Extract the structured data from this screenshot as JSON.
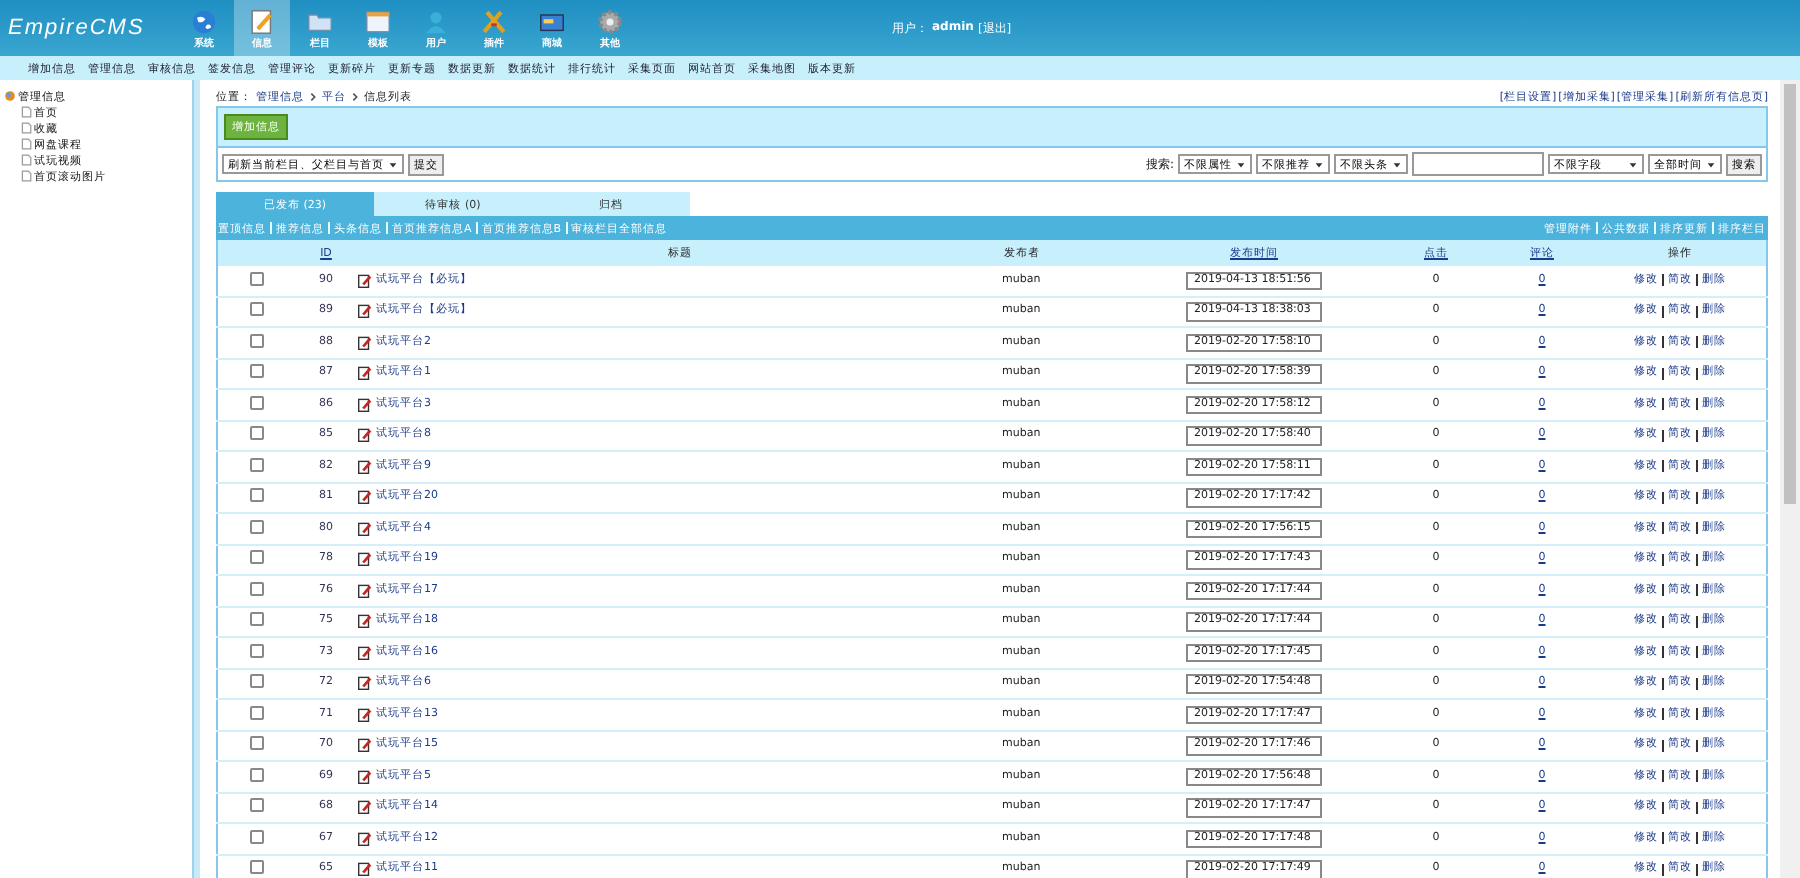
{
  "header": {
    "logo": "EmpireCMS",
    "nav": [
      {
        "label": "系统",
        "selected": false
      },
      {
        "label": "信息",
        "selected": true
      },
      {
        "label": "栏目",
        "selected": false
      },
      {
        "label": "模板",
        "selected": false
      },
      {
        "label": "用户",
        "selected": false
      },
      {
        "label": "插件",
        "selected": false
      },
      {
        "label": "商城",
        "selected": false
      },
      {
        "label": "其他",
        "selected": false
      }
    ],
    "user_label": "用户：",
    "user": "admin",
    "logout": "[退出]"
  },
  "submenu": [
    "增加信息",
    "管理信息",
    "审核信息",
    "签发信息",
    "管理评论",
    "更新碎片",
    "更新专题",
    "数据更新",
    "数据统计",
    "排行统计",
    "采集页面",
    "网站首页",
    "采集地图",
    "版本更新"
  ],
  "sidebar": {
    "root": "管理信息",
    "children": [
      {
        "label": "首页"
      },
      {
        "label": "收藏"
      },
      {
        "label": "网盘课程"
      },
      {
        "label": "试玩视频"
      },
      {
        "label": "首页滚动图片"
      }
    ]
  },
  "breadcrumb": {
    "label": "位置：",
    "items": [
      "管理信息",
      "平台",
      "信息列表"
    ]
  },
  "top_links": [
    "[栏目设置]",
    "[增加采集]",
    "[管理采集]",
    "[刷新所有信息页]"
  ],
  "add_button": "增加信息",
  "refresh_select": "刷新当前栏目、父栏目与首页",
  "submit_button": "提交",
  "search": {
    "label": "搜索:",
    "selects": [
      "不限属性",
      "不限推荐",
      "不限头条"
    ],
    "field_select": "不限字段",
    "time_select": "全部时间",
    "button": "搜索"
  },
  "tabs": [
    {
      "label": "已发布 (23)",
      "selected": true
    },
    {
      "label": "待审核 (0)",
      "selected": false
    },
    {
      "label": "归档",
      "selected": false
    }
  ],
  "filter_links": [
    "置顶信息",
    "推荐信息",
    "头条信息",
    "首页推荐信息A",
    "首页推荐信息B",
    "审核栏目全部信息"
  ],
  "tool_links": [
    "管理附件",
    "公共数据",
    "排序更新",
    "排序栏目"
  ],
  "table": {
    "columns": [
      "ID",
      "标题",
      "发布者",
      "发布时间",
      "点击",
      "评论",
      "操作"
    ],
    "rows": [
      {
        "checked": false,
        "id": "90",
        "title": "试玩平台【必玩】",
        "author": "muban",
        "time": "2019-04-13 18:51:56",
        "clicks": "0",
        "comments": "0",
        "actions": [
          "修改",
          "简改",
          "删除"
        ]
      },
      {
        "checked": false,
        "id": "89",
        "title": "试玩平台【必玩】",
        "author": "muban",
        "time": "2019-04-13 18:38:03",
        "clicks": "0",
        "comments": "0",
        "actions": [
          "修改",
          "简改",
          "删除"
        ]
      },
      {
        "checked": false,
        "id": "88",
        "title": "试玩平台2",
        "author": "muban",
        "time": "2019-02-20 17:58:10",
        "clicks": "0",
        "comments": "0",
        "actions": [
          "修改",
          "简改",
          "删除"
        ]
      },
      {
        "checked": false,
        "id": "87",
        "title": "试玩平台1",
        "author": "muban",
        "time": "2019-02-20 17:58:39",
        "clicks": "0",
        "comments": "0",
        "actions": [
          "修改",
          "简改",
          "删除"
        ]
      },
      {
        "checked": false,
        "id": "86",
        "title": "试玩平台3",
        "author": "muban",
        "time": "2019-02-20 17:58:12",
        "clicks": "0",
        "comments": "0",
        "actions": [
          "修改",
          "简改",
          "删除"
        ]
      },
      {
        "checked": false,
        "id": "85",
        "title": "试玩平台8",
        "author": "muban",
        "time": "2019-02-20 17:58:40",
        "clicks": "0",
        "comments": "0",
        "actions": [
          "修改",
          "简改",
          "删除"
        ]
      },
      {
        "checked": false,
        "id": "82",
        "title": "试玩平台9",
        "author": "muban",
        "time": "2019-02-20 17:58:11",
        "clicks": "0",
        "comments": "0",
        "actions": [
          "修改",
          "简改",
          "删除"
        ]
      },
      {
        "checked": false,
        "id": "81",
        "title": "试玩平台20",
        "author": "muban",
        "time": "2019-02-20 17:17:42",
        "clicks": "0",
        "comments": "0",
        "actions": [
          "修改",
          "简改",
          "删除"
        ]
      },
      {
        "checked": false,
        "id": "80",
        "title": "试玩平台4",
        "author": "muban",
        "time": "2019-02-20 17:56:15",
        "clicks": "0",
        "comments": "0",
        "actions": [
          "修改",
          "简改",
          "删除"
        ]
      },
      {
        "checked": false,
        "id": "78",
        "title": "试玩平台19",
        "author": "muban",
        "time": "2019-02-20 17:17:43",
        "clicks": "0",
        "comments": "0",
        "actions": [
          "修改",
          "简改",
          "删除"
        ]
      },
      {
        "checked": false,
        "id": "76",
        "title": "试玩平台17",
        "author": "muban",
        "time": "2019-02-20 17:17:44",
        "clicks": "0",
        "comments": "0",
        "actions": [
          "修改",
          "简改",
          "删除"
        ]
      },
      {
        "checked": false,
        "id": "75",
        "title": "试玩平台18",
        "author": "muban",
        "time": "2019-02-20 17:17:44",
        "clicks": "0",
        "comments": "0",
        "actions": [
          "修改",
          "简改",
          "删除"
        ]
      },
      {
        "checked": false,
        "id": "73",
        "title": "试玩平台16",
        "author": "muban",
        "time": "2019-02-20 17:17:45",
        "clicks": "0",
        "comments": "0",
        "actions": [
          "修改",
          "简改",
          "删除"
        ]
      },
      {
        "checked": false,
        "id": "72",
        "title": "试玩平台6",
        "author": "muban",
        "time": "2019-02-20 17:54:48",
        "clicks": "0",
        "comments": "0",
        "actions": [
          "修改",
          "简改",
          "删除"
        ]
      },
      {
        "checked": false,
        "id": "71",
        "title": "试玩平台13",
        "author": "muban",
        "time": "2019-02-20 17:17:47",
        "clicks": "0",
        "comments": "0",
        "actions": [
          "修改",
          "简改",
          "删除"
        ]
      },
      {
        "checked": false,
        "id": "70",
        "title": "试玩平台15",
        "author": "muban",
        "time": "2019-02-20 17:17:46",
        "clicks": "0",
        "comments": "0",
        "actions": [
          "修改",
          "简改",
          "删除"
        ]
      },
      {
        "checked": false,
        "id": "69",
        "title": "试玩平台5",
        "author": "muban",
        "time": "2019-02-20 17:56:48",
        "clicks": "0",
        "comments": "0",
        "actions": [
          "修改",
          "简改",
          "删除"
        ]
      },
      {
        "checked": false,
        "id": "68",
        "title": "试玩平台14",
        "author": "muban",
        "time": "2019-02-20 17:17:47",
        "clicks": "0",
        "comments": "0",
        "actions": [
          "修改",
          "简改",
          "删除"
        ]
      },
      {
        "checked": false,
        "id": "67",
        "title": "试玩平台12",
        "author": "muban",
        "time": "2019-02-20 17:17:48",
        "clicks": "0",
        "comments": "0",
        "actions": [
          "修改",
          "简改",
          "删除"
        ]
      },
      {
        "checked": false,
        "id": "65",
        "title": "试玩平台11",
        "author": "muban",
        "time": "2019-02-20 17:17:49",
        "clicks": "0",
        "comments": "0",
        "actions": [
          "修改",
          "简改",
          "删除"
        ]
      }
    ]
  }
}
